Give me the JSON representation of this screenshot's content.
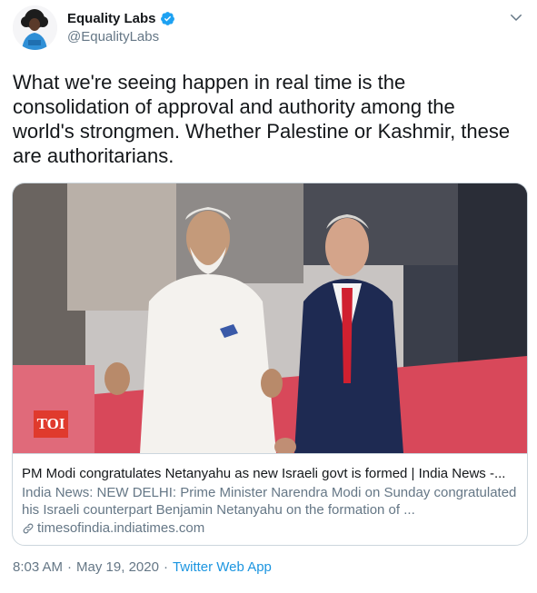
{
  "author": {
    "display_name": "Equality Labs",
    "handle": "@EqualityLabs",
    "verified": true
  },
  "tweet": {
    "text": "What we're seeing happen in real time is the consolidation of approval and authority among the world's strongmen. Whether Palestine or Kashmir, these are authoritarians."
  },
  "card": {
    "badge": "TOI",
    "title": "PM Modi congratulates Netanyahu as new Israeli govt is formed | India News -...",
    "description": "India News: NEW DELHI: Prime Minister Narendra Modi on Sunday congratulated his Israeli counterpart Benjamin Netanyahu on the formation of ...",
    "domain": "timesofindia.indiatimes.com"
  },
  "meta": {
    "time": "8:03 AM",
    "separator1": "·",
    "date": "May 19, 2020",
    "separator2": "·",
    "app": "Twitter Web App"
  },
  "icons": {
    "verified": "verified-badge-icon",
    "chevron": "chevron-down-icon",
    "link": "link-icon"
  },
  "colors": {
    "link_blue": "#1b95e0",
    "verified_blue": "#1da1f2",
    "secondary_text": "#657786",
    "toi_red": "#e03a2d"
  }
}
